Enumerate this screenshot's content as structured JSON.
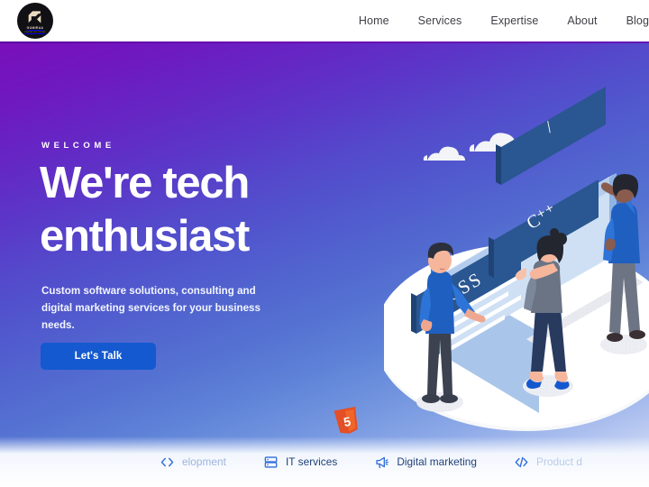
{
  "header": {
    "logo": {
      "name": "gumiraa-logo",
      "wordmark": "GUMIRAA",
      "tagline": "DIGITAL SOLUTIONS",
      "bg_color": "#111014",
      "mark_color": "#e9d9bf"
    },
    "nav": [
      {
        "label": "Home",
        "name": "nav-link-home"
      },
      {
        "label": "Services",
        "name": "nav-link-services"
      },
      {
        "label": "Expertise",
        "name": "nav-link-expertise"
      },
      {
        "label": "About",
        "name": "nav-link-about"
      },
      {
        "label": "Blog",
        "name": "nav-link-blog"
      }
    ]
  },
  "hero": {
    "eyebrow": "WELCOME",
    "headline_line1": "We're tech",
    "headline_line2": "enthusiast",
    "subcopy": "Custom software solutions, consulting and digital marketing services for your business needs.",
    "cta_label": "Let's Talk",
    "cta_color": "#1459cf",
    "gradient_start": "#7a0fbb",
    "gradient_end": "#e6ecfa",
    "badge": {
      "name": "html5-logo",
      "text": "5",
      "color": "#e34f26"
    },
    "illustration": {
      "name": "web-development-illustration",
      "code_labels": [
        "/",
        "CSS",
        "C++"
      ],
      "people_count": 3,
      "cloud_count": 2
    }
  },
  "feature_strip": {
    "items": [
      {
        "label": "elopment",
        "icon": "code-brackets-icon",
        "name": "feature-web-development",
        "state": "clipped"
      },
      {
        "label": "IT services",
        "icon": "server-stack-icon",
        "name": "feature-it-services",
        "state": "visible"
      },
      {
        "label": "Digital marketing",
        "icon": "megaphone-icon",
        "name": "feature-digital-marketing",
        "state": "visible"
      },
      {
        "label": "Product d",
        "icon": "code-tag-icon",
        "name": "feature-product-design",
        "state": "clipped"
      }
    ]
  }
}
